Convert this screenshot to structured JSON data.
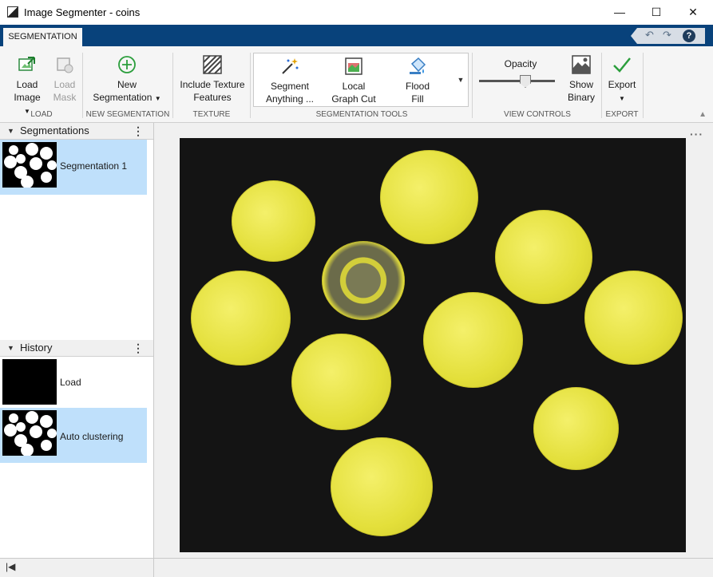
{
  "window": {
    "title": "Image Segmenter - coins",
    "minimize": "—",
    "maximize": "☐",
    "close": "✕"
  },
  "tabs": {
    "active": "SEGMENTATION"
  },
  "quick_access": {
    "undo": "↶",
    "redo": "↷",
    "help": "?"
  },
  "ribbon": {
    "load": {
      "load_image_1": "Load",
      "load_image_2": "Image",
      "load_mask_1": "Load",
      "load_mask_2": "Mask",
      "label": "LOAD"
    },
    "new_seg": {
      "line1": "New",
      "line2": "Segmentation",
      "label": "NEW SEGMENTATION"
    },
    "texture": {
      "line1": "Include Texture",
      "line2": "Features",
      "label": "TEXTURE"
    },
    "tools": {
      "segment_anything_1": "Segment",
      "segment_anything_2": "Anything ...",
      "local_graph_cut_1": "Local",
      "local_graph_cut_2": "Graph Cut",
      "flood_fill_1": "Flood",
      "flood_fill_2": "Fill",
      "label": "SEGMENTATION TOOLS"
    },
    "view": {
      "opacity": "Opacity",
      "opacity_level": 0.6,
      "show_binary_1": "Show",
      "show_binary_2": "Binary",
      "label": "VIEW CONTROLS"
    },
    "export": {
      "line1": "Export",
      "label": "EXPORT"
    }
  },
  "segmentations": {
    "title": "Segmentations",
    "items": [
      {
        "label": "Segmentation 1"
      }
    ]
  },
  "history": {
    "title": "History",
    "items": [
      {
        "label": "Load"
      },
      {
        "label": "Auto clustering"
      }
    ]
  },
  "colors": {
    "accent": "#08427b",
    "selection": "#bfe0fb",
    "overlay": "#e6e23a"
  }
}
